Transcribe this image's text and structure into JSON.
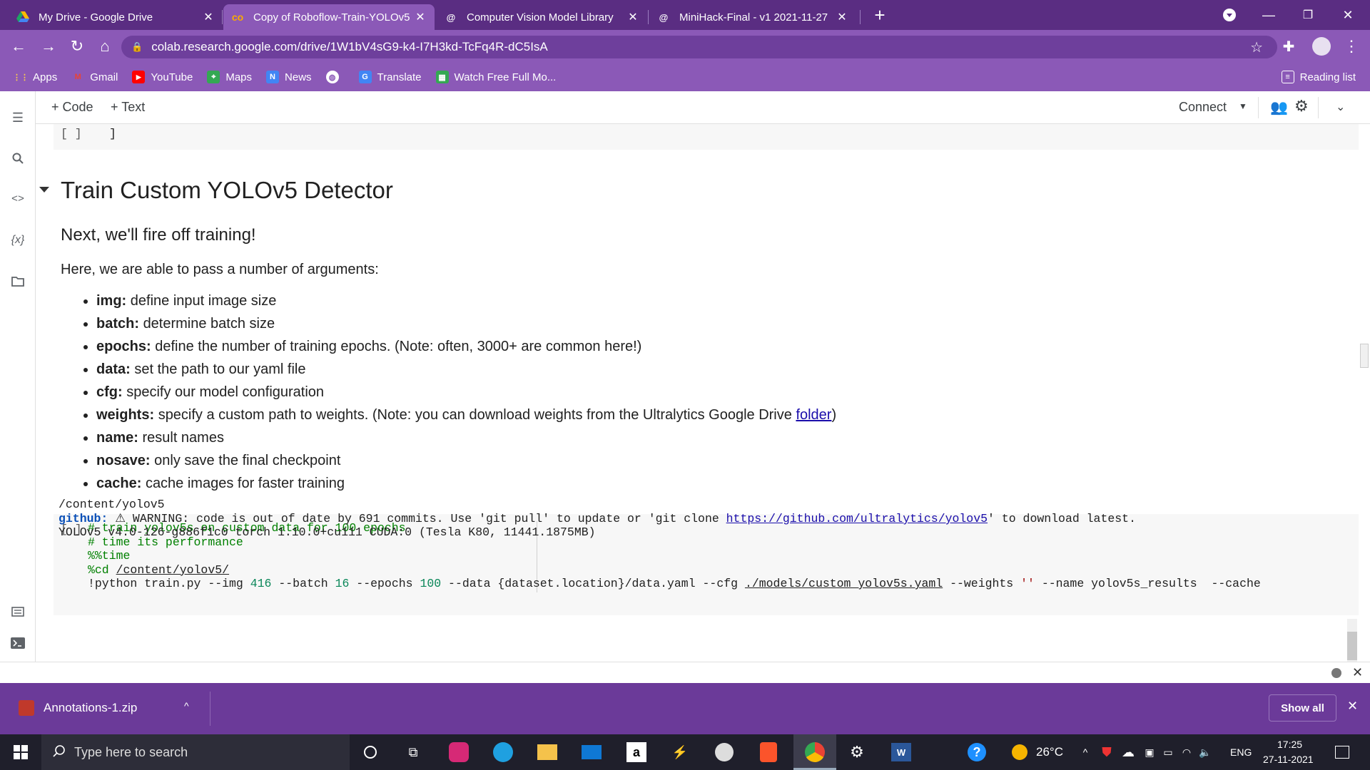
{
  "browser": {
    "tabs": [
      {
        "title": "My Drive - Google Drive",
        "icon": "google-drive-icon"
      },
      {
        "title": "Copy of Roboflow-Train-YOLOv5",
        "icon": "colab-icon"
      },
      {
        "title": "Computer Vision Model Library",
        "icon": "roboflow-icon"
      },
      {
        "title": "MiniHack-Final - v1 2021-11-27",
        "icon": "roboflow-icon"
      }
    ],
    "url": "colab.research.google.com/drive/1W1bV4sG9-k4-I7H3kd-TcFq4R-dC5IsA",
    "bookmarks": [
      "Apps",
      "Gmail",
      "YouTube",
      "Maps",
      "News",
      "Translate",
      "Watch Free Full Mo..."
    ],
    "reading_list": "Reading list"
  },
  "colab": {
    "add_code": "+ Code",
    "add_text": "+ Text",
    "connect": "Connect",
    "prev_cell_bracket": "[ ]",
    "prev_cell_code": "]",
    "section_title": "Train Custom YOLOv5 Detector",
    "subtitle": "Next, we'll fire off training!",
    "paragraph": "Here, we are able to pass a number of arguments:",
    "args": [
      {
        "key": "img:",
        "desc": "define input image size"
      },
      {
        "key": "batch:",
        "desc": "determine batch size"
      },
      {
        "key": "epochs:",
        "desc": "define the number of training epochs. (Note: often, 3000+ are common here!)"
      },
      {
        "key": "data:",
        "desc": "set the path to our yaml file"
      },
      {
        "key": "cfg:",
        "desc": "specify our model configuration"
      },
      {
        "key": "weights:",
        "desc": "specify a custom path to weights. (Note: you can download weights from the Ultralytics Google Drive ",
        "link": "folder",
        "after": ")"
      },
      {
        "key": "name:",
        "desc": "result names"
      },
      {
        "key": "nosave:",
        "desc": "only save the final checkpoint"
      },
      {
        "key": "cache:",
        "desc": "cache images for faster training"
      }
    ],
    "code_bracket": "[ ]",
    "code": {
      "line1": "# train yolov5s on custom data for 100 epochs",
      "line2": "# time its performance",
      "line3": "%%time",
      "line4_cmd": "%cd ",
      "line4_path": "/content/yolov5/",
      "line5_a": "!python train.py --img ",
      "line5_img": "416",
      "line5_b": " --batch ",
      "line5_batch": "16",
      "line5_c": " --epochs ",
      "line5_epochs": "100",
      "line5_d": " --data {dataset.location}/data.yaml --cfg ",
      "line5_cfg": "./models/custom_yolov5s.yaml",
      "line5_e": " --weights ",
      "line5_w": "''",
      "line5_f": " --name yolov5s_results  --cache"
    },
    "output": {
      "line1": "/content/yolov5",
      "line2_label": "github: ",
      "line2_text": " WARNING: code is out of date by 691 commits. Use 'git pull' to update or 'git clone ",
      "line2_link": "https://github.com/ultralytics/yolov5",
      "line2_end": "' to download latest.",
      "line3": "YOLOv5 v4.0-126-g886f1c0 torch 1.10.0+cu111 CUDA:0 (Tesla K80, 11441.1875MB)"
    }
  },
  "download": {
    "file": "Annotations-1.zip",
    "show_all": "Show all"
  },
  "taskbar": {
    "search_placeholder": "Type here to search",
    "weather": "26°C",
    "lang": "ENG",
    "time": "17:25",
    "date": "27-11-2021"
  }
}
